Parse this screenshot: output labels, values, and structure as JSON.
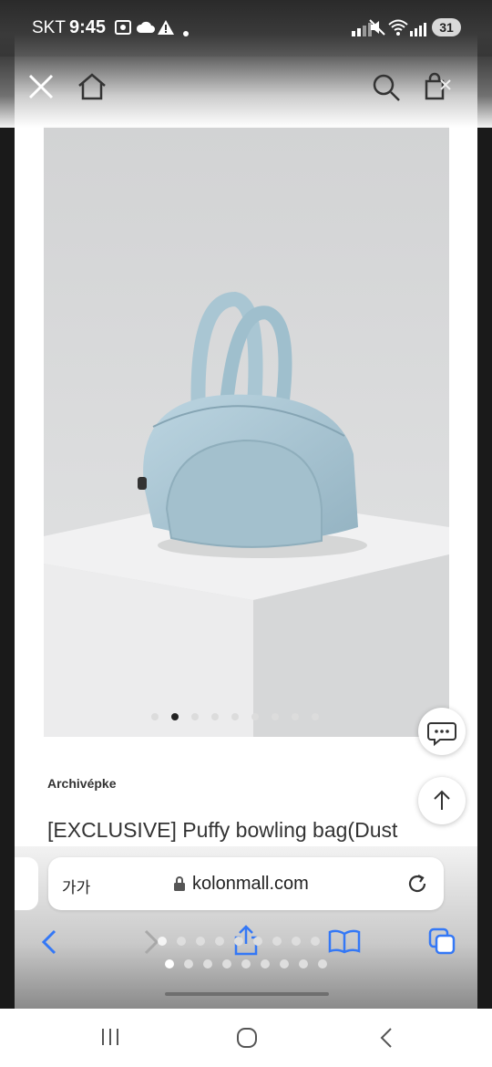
{
  "status_bar": {
    "carrier": "SKT",
    "time": "9:45",
    "battery": "31"
  },
  "product": {
    "brand": "Archivépke",
    "title": "[EXCLUSIVE] Puffy bowling bag(Dust",
    "image_alt": "Puffy bowling bag in dusty light blue on white pedestal",
    "carousel": {
      "total": 9,
      "active": 1
    }
  },
  "browser": {
    "text_size_label": "가가",
    "url": "kolonmall.com",
    "tab_pages": {
      "total": 9,
      "active": 1
    }
  },
  "colors": {
    "bag": "#a9c6d3",
    "accent_blue": "#3478f6",
    "background_grey": "#d9dadb"
  },
  "icons": {
    "nav": [
      "close-icon",
      "home-icon",
      "search-icon",
      "shopping-bag-icon"
    ],
    "floating": [
      "chat-icon",
      "arrow-up-icon"
    ],
    "toolbar": [
      "back-icon",
      "forward-icon",
      "share-icon",
      "bookmarks-icon",
      "tabs-icon"
    ],
    "android": [
      "recents-icon",
      "home-circle-icon",
      "android-back-icon"
    ]
  }
}
